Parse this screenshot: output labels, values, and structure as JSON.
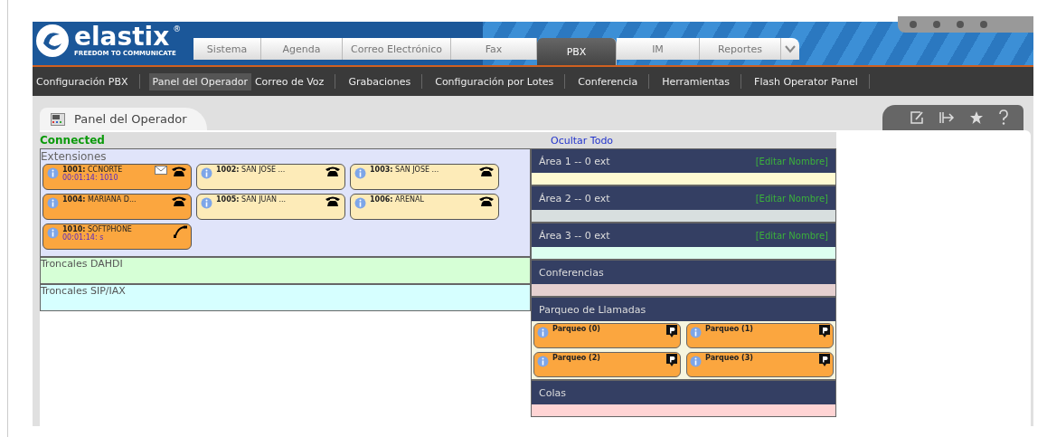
{
  "logo": {
    "name": "elastix",
    "mark": "®",
    "tagline": "FREEDOM TO COMMUNICATE"
  },
  "tabs": [
    {
      "label": "Sistema",
      "selected": false
    },
    {
      "label": "Agenda",
      "selected": false
    },
    {
      "label": "Correo Electrónico",
      "selected": false
    },
    {
      "label": "Fax",
      "selected": false
    },
    {
      "label": "PBX",
      "selected": true
    },
    {
      "label": "IM",
      "selected": false
    },
    {
      "label": "Reportes",
      "selected": false
    }
  ],
  "subnav": [
    {
      "label": "Configuración PBX",
      "selected": false
    },
    {
      "label": "Panel del Operador",
      "selected": true
    },
    {
      "label": "Correo de Voz",
      "selected": false
    },
    {
      "label": "Grabaciones",
      "selected": false
    },
    {
      "label": "Configuración por Lotes",
      "selected": false
    },
    {
      "label": "Conferencia",
      "selected": false
    },
    {
      "label": "Herramientas",
      "selected": false
    },
    {
      "label": "Flash Operator Panel",
      "selected": false
    }
  ],
  "page_tab": {
    "label": "Panel del Operador"
  },
  "status": "Connected",
  "hide_all": "Ocultar Todo",
  "extensions": {
    "title": "Extensiones",
    "items": [
      {
        "number": "1001:",
        "name": "CCNORTE",
        "detail": "00:01:14: 1010",
        "busy": true,
        "voicemail": true,
        "kind": "desk"
      },
      {
        "number": "1002:",
        "name": "SAN JOSE ...",
        "busy": false,
        "voicemail": false,
        "kind": "desk"
      },
      {
        "number": "1003:",
        "name": "SAN JOSE ...",
        "busy": false,
        "voicemail": false,
        "kind": "desk"
      },
      {
        "number": "1004:",
        "name": "MARIANA D...",
        "busy": true,
        "voicemail": false,
        "kind": "desk"
      },
      {
        "number": "1005:",
        "name": "SAN JUAN ...",
        "busy": false,
        "voicemail": false,
        "kind": "desk"
      },
      {
        "number": "1006:",
        "name": "ARENAL",
        "busy": false,
        "voicemail": false,
        "kind": "desk"
      },
      {
        "number": "1010:",
        "name": "SOFTPHONE",
        "detail": "00:01:14: s",
        "busy": true,
        "voicemail": false,
        "kind": "soft"
      }
    ]
  },
  "trunks": [
    {
      "title": "Troncales DAHDI",
      "color": "#d6ffd6"
    },
    {
      "title": "Troncales SIP/IAX",
      "color": "#d6ffff"
    }
  ],
  "areas": [
    {
      "title": "Área 1 -- 0 ext",
      "action": "[Editar Nombre]",
      "color": "#fffad2"
    },
    {
      "title": "Área 2 -- 0 ext",
      "action": "[Editar Nombre]",
      "color": "#d8dfdf"
    },
    {
      "title": "Área 3 -- 0 ext",
      "action": "[Editar Nombre]",
      "color": "#ddfff0"
    }
  ],
  "conferences": {
    "title": "Conferencias",
    "color": "#e5d0d0"
  },
  "parking": {
    "title": "Parqueo de Llamadas",
    "items": [
      "Parqueo (0)",
      "Parqueo (1)",
      "Parqueo (2)",
      "Parqueo (3)"
    ]
  },
  "queues": {
    "title": "Colas",
    "color": "#ffd4d4"
  }
}
